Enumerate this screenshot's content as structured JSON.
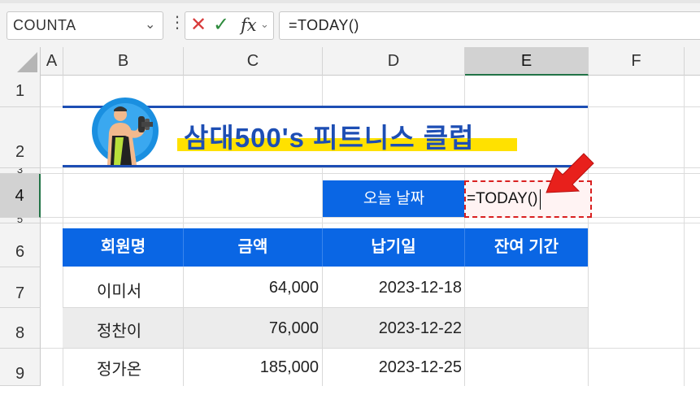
{
  "formula_bar": {
    "name_box": "COUNTA",
    "dots": "⋮",
    "cancel": "✕",
    "enter": "✓",
    "fx": "fx",
    "formula": "=TODAY()"
  },
  "columns": [
    "A",
    "B",
    "C",
    "D",
    "E",
    "F"
  ],
  "rows": [
    "1",
    "2",
    "3",
    "4",
    "5",
    "6",
    "7",
    "8",
    "9"
  ],
  "title": "삼대500's 피트니스 클럽",
  "today_label": "오늘 날짜",
  "today_editing": "=TODAY()",
  "table": {
    "headers": [
      "회원명",
      "금액",
      "납기일",
      "잔여 기간"
    ],
    "rows": [
      {
        "name": "이미서",
        "amount": "64,000",
        "due": "2023-12-18",
        "remain": ""
      },
      {
        "name": "정찬이",
        "amount": "76,000",
        "due": "2023-12-22",
        "remain": ""
      },
      {
        "name": "정가온",
        "amount": "185,000",
        "due": "2023-12-25",
        "remain": ""
      }
    ]
  },
  "colors": {
    "accent_blue": "#0a66e4",
    "title_blue": "#1d4eb4",
    "highlight_yellow": "#ffe100",
    "arrow_red": "#e8201c",
    "selection_green": "#217346"
  }
}
